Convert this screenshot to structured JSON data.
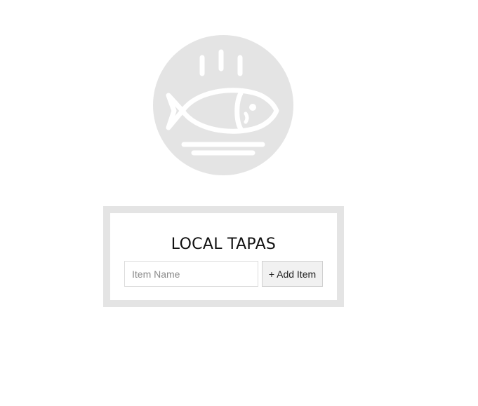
{
  "logo": {
    "icon": "fish-plate-icon",
    "circle_color": "#e4e4e4",
    "glyph_color": "#ffffff"
  },
  "card": {
    "title": "LOCAL TAPAS",
    "frame_color": "#e4e4e4"
  },
  "form": {
    "item_name_placeholder": "Item Name",
    "item_name_value": "",
    "add_button_label": "+ Add Item"
  }
}
